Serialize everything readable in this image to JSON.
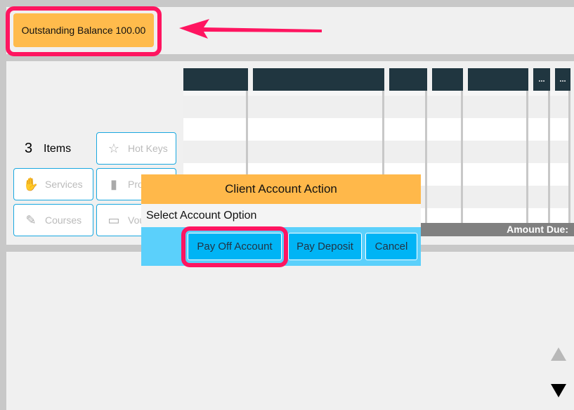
{
  "header": {
    "outstanding_balance": "Outstanding Balance 100.00"
  },
  "table": {
    "columns": [
      "",
      "",
      "",
      "",
      "",
      "...",
      "..."
    ],
    "footer": "Amount Due:"
  },
  "items": {
    "count": "3",
    "label": "Items"
  },
  "categories": [
    {
      "label": "Hot Keys",
      "icon": "star-icon"
    },
    {
      "label": "Services",
      "icon": "handshake-icon"
    },
    {
      "label": "Pro",
      "icon": "bottle-icon"
    },
    {
      "label": "Courses",
      "icon": "clipboard-icon"
    },
    {
      "label": "Vou",
      "icon": "gift-card-icon"
    }
  ],
  "dialog": {
    "title": "Client Account Action",
    "message": "Select Account Option",
    "buttons": [
      "Pay Off Account",
      "Pay Deposit",
      "Cancel"
    ]
  },
  "annotation_color": "#ff1560"
}
